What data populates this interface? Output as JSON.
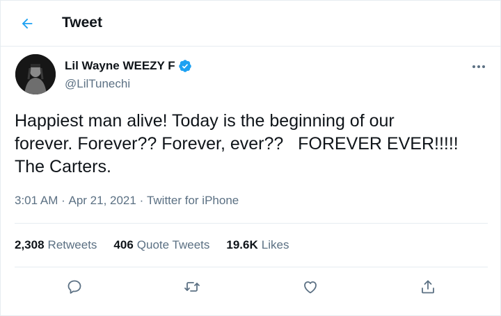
{
  "header": {
    "title": "Tweet",
    "back_icon": "arrow-left-icon",
    "accent_color": "#1da1f2"
  },
  "author": {
    "name": "Lil Wayne WEEZY F",
    "handle": "@LilTunechi",
    "verified": true,
    "verified_color": "#1da1f2"
  },
  "tweet": {
    "text": "Happiest man alive! Today is the beginning of our\nforever. Forever?? Forever, ever??   FOREVER EVER!!!!!\nThe Carters.",
    "time": "3:01 AM",
    "separator": " · ",
    "date": "Apr 21, 2021",
    "source": "Twitter for iPhone"
  },
  "stats": [
    {
      "count": "2,308",
      "label": "Retweets"
    },
    {
      "count": "406",
      "label": "Quote Tweets"
    },
    {
      "count": "19.6K",
      "label": "Likes"
    }
  ],
  "actions": [
    "reply-icon",
    "retweet-icon",
    "like-icon",
    "share-icon"
  ],
  "colors": {
    "text": "#0f1419",
    "secondary": "#5b7083",
    "border": "#e6ecf0"
  }
}
